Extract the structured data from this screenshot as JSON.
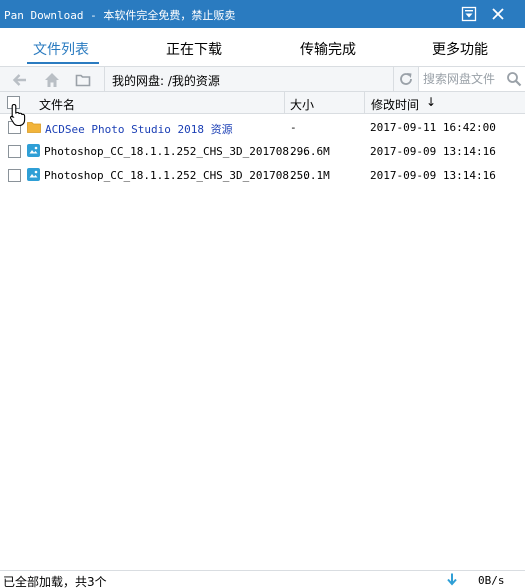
{
  "window": {
    "title": "Pan Download - 本软件完全免费，禁止贩卖"
  },
  "tabs": [
    {
      "label": "文件列表",
      "active": true
    },
    {
      "label": "正在下载",
      "active": false
    },
    {
      "label": "传输完成",
      "active": false
    },
    {
      "label": "更多功能",
      "active": false
    }
  ],
  "toolbar": {
    "path": "我的网盘: /我的资源",
    "search_placeholder": "搜索网盘文件"
  },
  "table": {
    "headers": {
      "name": "文件名",
      "size": "大小",
      "modified": "修改时间",
      "sort_indicator": "↓"
    },
    "rows": [
      {
        "type": "folder",
        "name": "ACDSee Photo Studio 2018 资源",
        "size": "-",
        "modified": "2017-09-11 16:42:00"
      },
      {
        "type": "file",
        "name": "Photoshop_CC_18.1.1.252_CHS_3D_201708...",
        "size": "296.6M",
        "modified": "2017-09-09 13:14:16"
      },
      {
        "type": "file",
        "name": "Photoshop_CC_18.1.1.252_CHS_3D_201708...",
        "size": "250.1M",
        "modified": "2017-09-09 13:14:16"
      }
    ]
  },
  "status": {
    "text": "已全部加载，共3个",
    "speed": "0B/s"
  },
  "colors": {
    "accent": "#2a7bc0",
    "folder_link": "#1b3fb5",
    "folder_icon": "#f2b43a",
    "file_icon": "#2f9fd6"
  }
}
